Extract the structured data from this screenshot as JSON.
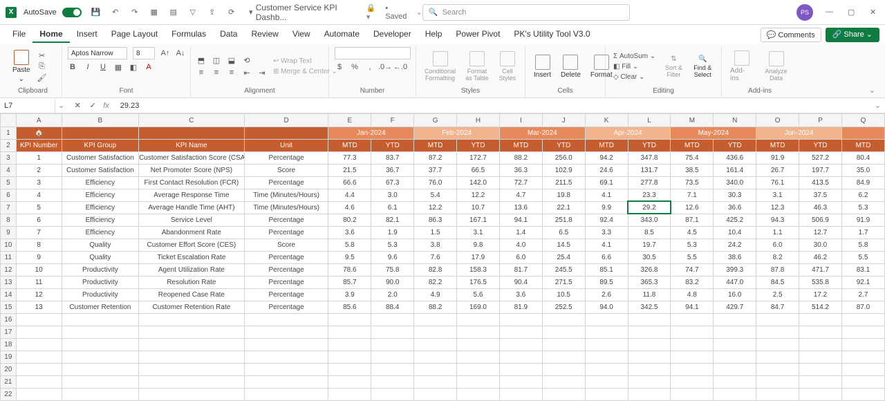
{
  "titlebar": {
    "autosave": "AutoSave",
    "doc_title": "Customer Service KPI Dashb...",
    "saved": "• Saved",
    "search_placeholder": "Search",
    "avatar": "PS"
  },
  "tabs": [
    "File",
    "Home",
    "Insert",
    "Page Layout",
    "Formulas",
    "Data",
    "Review",
    "View",
    "Automate",
    "Developer",
    "Help",
    "Power Pivot",
    "PK's Utility Tool V3.0"
  ],
  "active_tab": "Home",
  "ribbon_right": {
    "comments": "Comments",
    "share": "Share"
  },
  "ribbon": {
    "clipboard": {
      "paste": "Paste",
      "label": "Clipboard"
    },
    "font": {
      "name": "Aptos Narrow",
      "size": "8",
      "label": "Font"
    },
    "alignment": {
      "wrap": "Wrap Text",
      "merge": "Merge & Center",
      "label": "Alignment"
    },
    "number": {
      "label": "Number"
    },
    "styles": {
      "cf": "Conditional Formatting",
      "fat": "Format as Table",
      "cs": "Cell Styles",
      "label": "Styles"
    },
    "cells": {
      "insert": "Insert",
      "delete": "Delete",
      "format": "Format",
      "label": "Cells"
    },
    "editing": {
      "autosum": "AutoSum",
      "fill": "Fill",
      "clear": "Clear",
      "sort": "Sort & Filter",
      "find": "Find & Select",
      "label": "Editing"
    },
    "addins": {
      "addins": "Add-ins",
      "analyze": "Analyze Data",
      "label": "Add-ins"
    }
  },
  "formula_bar": {
    "cell_ref": "L7",
    "value": "29.23"
  },
  "col_letters": [
    "A",
    "B",
    "C",
    "D",
    "E",
    "F",
    "G",
    "H",
    "I",
    "J",
    "K",
    "L",
    "M",
    "N",
    "O",
    "P",
    "Q"
  ],
  "months": [
    "Jan-2024",
    "Feb-2024",
    "Mar-2024",
    "Apr-2024",
    "May-2024",
    "Jun-2024"
  ],
  "headers": {
    "kpi_num": "KPI Number",
    "kpi_group": "KPI Group",
    "kpi_name": "KPI Name",
    "unit": "Unit",
    "mtd": "MTD",
    "ytd": "YTD"
  },
  "rows": [
    {
      "n": "1",
      "g": "Customer Satisfaction",
      "name": "Customer Satisfaction Score (CSAT)",
      "u": "Percentage",
      "v": [
        "77.3",
        "83.7",
        "87.2",
        "172.7",
        "88.2",
        "256.0",
        "94.2",
        "347.8",
        "75.4",
        "436.6",
        "91.9",
        "527.2",
        "80.4"
      ]
    },
    {
      "n": "2",
      "g": "Customer Satisfaction",
      "name": "Net Promoter Score (NPS)",
      "u": "Score",
      "v": [
        "21.5",
        "36.7",
        "37.7",
        "66.5",
        "36.3",
        "102.9",
        "24.6",
        "131.7",
        "38.5",
        "161.4",
        "26.7",
        "197.7",
        "35.0"
      ]
    },
    {
      "n": "3",
      "g": "Efficiency",
      "name": "First Contact Resolution (FCR)",
      "u": "Percentage",
      "v": [
        "66.6",
        "67.3",
        "76.0",
        "142.0",
        "72.7",
        "211.5",
        "69.1",
        "277.8",
        "73.5",
        "340.0",
        "76.1",
        "413.5",
        "84.9"
      ]
    },
    {
      "n": "4",
      "g": "Efficiency",
      "name": "Average Response Time",
      "u": "Time (Minutes/Hours)",
      "v": [
        "4.4",
        "3.0",
        "5.4",
        "12.2",
        "4.7",
        "19.8",
        "4.1",
        "23.3",
        "7.1",
        "30.3",
        "3.1",
        "37.5",
        "6.2"
      ]
    },
    {
      "n": "5",
      "g": "Efficiency",
      "name": "Average Handle Time (AHT)",
      "u": "Time (Minutes/Hours)",
      "v": [
        "4.6",
        "6.1",
        "12.2",
        "10.7",
        "13.6",
        "22.1",
        "9.9",
        "29.2",
        "12.6",
        "36.6",
        "12.3",
        "46.3",
        "5.3"
      ]
    },
    {
      "n": "6",
      "g": "Efficiency",
      "name": "Service Level",
      "u": "Percentage",
      "v": [
        "80.2",
        "82.1",
        "86.3",
        "167.1",
        "94.1",
        "251.8",
        "92.4",
        "343.0",
        "87.1",
        "425.2",
        "94.3",
        "506.9",
        "91.9"
      ]
    },
    {
      "n": "7",
      "g": "Efficiency",
      "name": "Abandonment Rate",
      "u": "Percentage",
      "v": [
        "3.6",
        "1.9",
        "1.5",
        "3.1",
        "1.4",
        "6.5",
        "3.3",
        "8.5",
        "4.5",
        "10.4",
        "1.1",
        "12.7",
        "1.7"
      ]
    },
    {
      "n": "8",
      "g": "Quality",
      "name": "Customer Effort Score (CES)",
      "u": "Score",
      "v": [
        "5.8",
        "5.3",
        "3.8",
        "9.8",
        "4.0",
        "14.5",
        "4.1",
        "19.7",
        "5.3",
        "24.2",
        "6.0",
        "30.0",
        "5.8"
      ]
    },
    {
      "n": "9",
      "g": "Quality",
      "name": "Ticket Escalation Rate",
      "u": "Percentage",
      "v": [
        "9.5",
        "9.6",
        "7.6",
        "17.9",
        "6.0",
        "25.4",
        "6.6",
        "30.5",
        "5.5",
        "38.6",
        "8.2",
        "46.2",
        "5.5"
      ]
    },
    {
      "n": "10",
      "g": "Productivity",
      "name": "Agent Utilization Rate",
      "u": "Percentage",
      "v": [
        "78.6",
        "75.8",
        "82.8",
        "158.3",
        "81.7",
        "245.5",
        "85.1",
        "326.8",
        "74.7",
        "399.3",
        "87.8",
        "471.7",
        "83.1"
      ]
    },
    {
      "n": "11",
      "g": "Productivity",
      "name": "Resolution Rate",
      "u": "Percentage",
      "v": [
        "85.7",
        "90.0",
        "82.2",
        "176.5",
        "90.4",
        "271.5",
        "89.5",
        "365.3",
        "83.2",
        "447.0",
        "84.5",
        "535.8",
        "92.1"
      ]
    },
    {
      "n": "12",
      "g": "Productivity",
      "name": "Reopened Case Rate",
      "u": "Percentage",
      "v": [
        "3.9",
        "2.0",
        "4.9",
        "5.6",
        "3.6",
        "10.5",
        "2.6",
        "11.8",
        "4.8",
        "16.0",
        "2.5",
        "17.2",
        "2.7"
      ]
    },
    {
      "n": "13",
      "g": "Customer Retention",
      "name": "Customer Retention Rate",
      "u": "Percentage",
      "v": [
        "85.6",
        "88.4",
        "88.2",
        "169.0",
        "81.9",
        "252.5",
        "94.0",
        "342.5",
        "94.1",
        "429.7",
        "84.7",
        "514.2",
        "87.0"
      ]
    }
  ],
  "selected": {
    "row": 5,
    "col": 7
  }
}
